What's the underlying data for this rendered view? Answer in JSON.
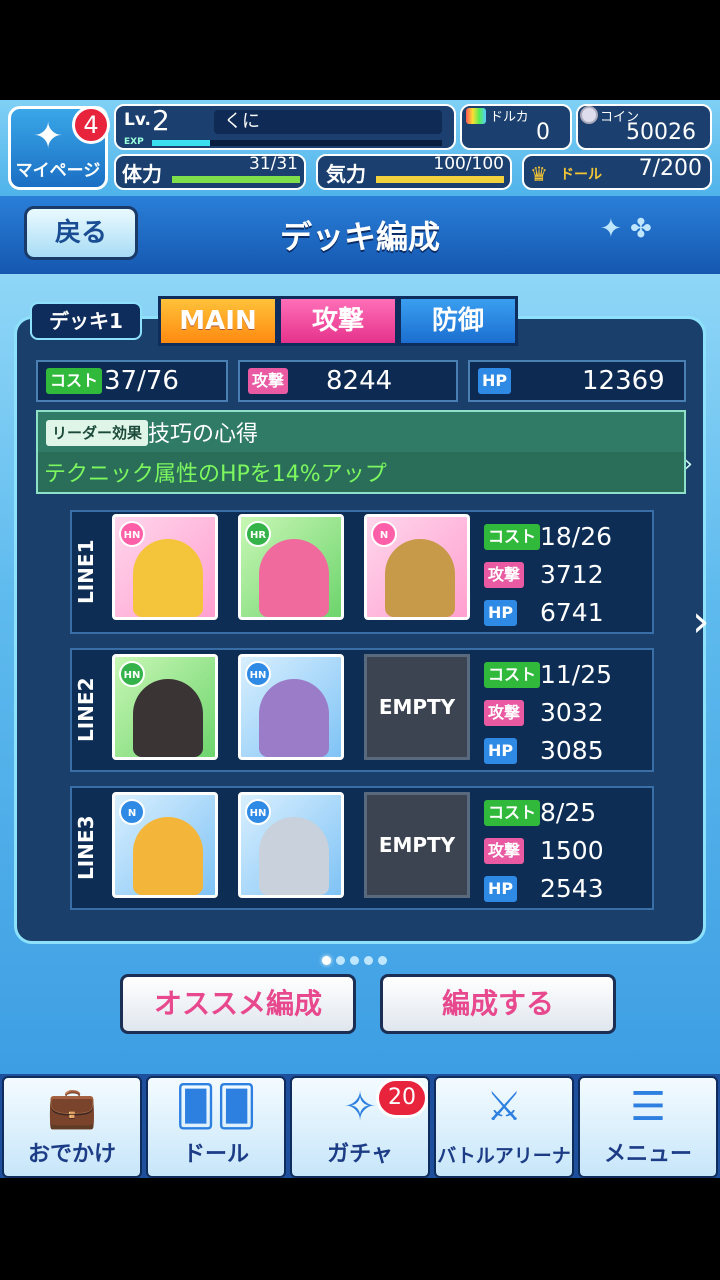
{
  "header": {
    "mypage_label": "マイページ",
    "mypage_badge": "4",
    "level_label": "Lv.",
    "level": "2",
    "exp_label": "EXP",
    "player_name": "くに",
    "stamina_label": "体力",
    "stamina_value": "31/31",
    "spirit_label": "気力",
    "spirit_value": "100/100",
    "dollcard_label": "ドルカ",
    "dollcard_value": "0",
    "coin_label": "コイン",
    "coin_value": "50026",
    "doll_label": "ドール",
    "doll_value": "7/200",
    "exp_fraction": 0.2,
    "stamina_fraction": 1.0,
    "spirit_fraction": 1.0
  },
  "title_bar": {
    "back_label": "戻る",
    "title": "デッキ編成"
  },
  "deck": {
    "name": "デッキ1",
    "tabs": [
      "MAIN",
      "攻撃",
      "防御"
    ],
    "cost_label": "コスト",
    "cost_value": "37/76",
    "atk_label": "攻撃",
    "atk_value": "8244",
    "hp_label": "HP",
    "hp_value": "12369",
    "leader_label": "リーダー効果",
    "leader_name": "技巧の心得",
    "leader_desc": "テクニック属性のHPを14%アップ"
  },
  "lines": [
    {
      "label": "LINE1",
      "cost": "18/26",
      "atk": "3712",
      "hp": "6741",
      "cards": [
        {
          "rarity": "HN",
          "type": "star"
        },
        {
          "rarity": "HR",
          "type": "tech"
        },
        {
          "rarity": "N",
          "type": "star"
        }
      ]
    },
    {
      "label": "LINE2",
      "cost": "11/25",
      "atk": "3032",
      "hp": "3085",
      "cards": [
        {
          "rarity": "HN",
          "type": "tech"
        },
        {
          "rarity": "HN",
          "type": "blue"
        },
        {
          "empty": "EMPTY"
        }
      ]
    },
    {
      "label": "LINE3",
      "cost": "8/25",
      "atk": "1500",
      "hp": "2543",
      "cards": [
        {
          "rarity": "N",
          "type": "blue"
        },
        {
          "rarity": "HN",
          "type": "blue"
        },
        {
          "empty": "EMPTY"
        }
      ]
    }
  ],
  "stat_labels": {
    "cost": "コスト",
    "atk": "攻撃",
    "hp": "HP"
  },
  "buttons": {
    "recommend": "オススメ編成",
    "form": "編成する"
  },
  "nav": [
    {
      "label": "おでかけ",
      "icon": "briefcase-icon"
    },
    {
      "label": "ドール",
      "icon": "cards-icon"
    },
    {
      "label": "ガチャ",
      "icon": "gacha-icon",
      "badge": "20"
    },
    {
      "label": "バトルアリーナ",
      "icon": "crossed-swords-icon"
    },
    {
      "label": "メニュー",
      "icon": "menu-icon"
    }
  ],
  "colors": {
    "main_tab": "#ff8a10",
    "attack_tab": "#e5328c",
    "defense_tab": "#1b6ed0",
    "cost_tag": "#31b93c",
    "attack_tag": "#e95aa3",
    "hp_tag": "#2f8ae5",
    "leader_desc": "#7cf75e"
  }
}
